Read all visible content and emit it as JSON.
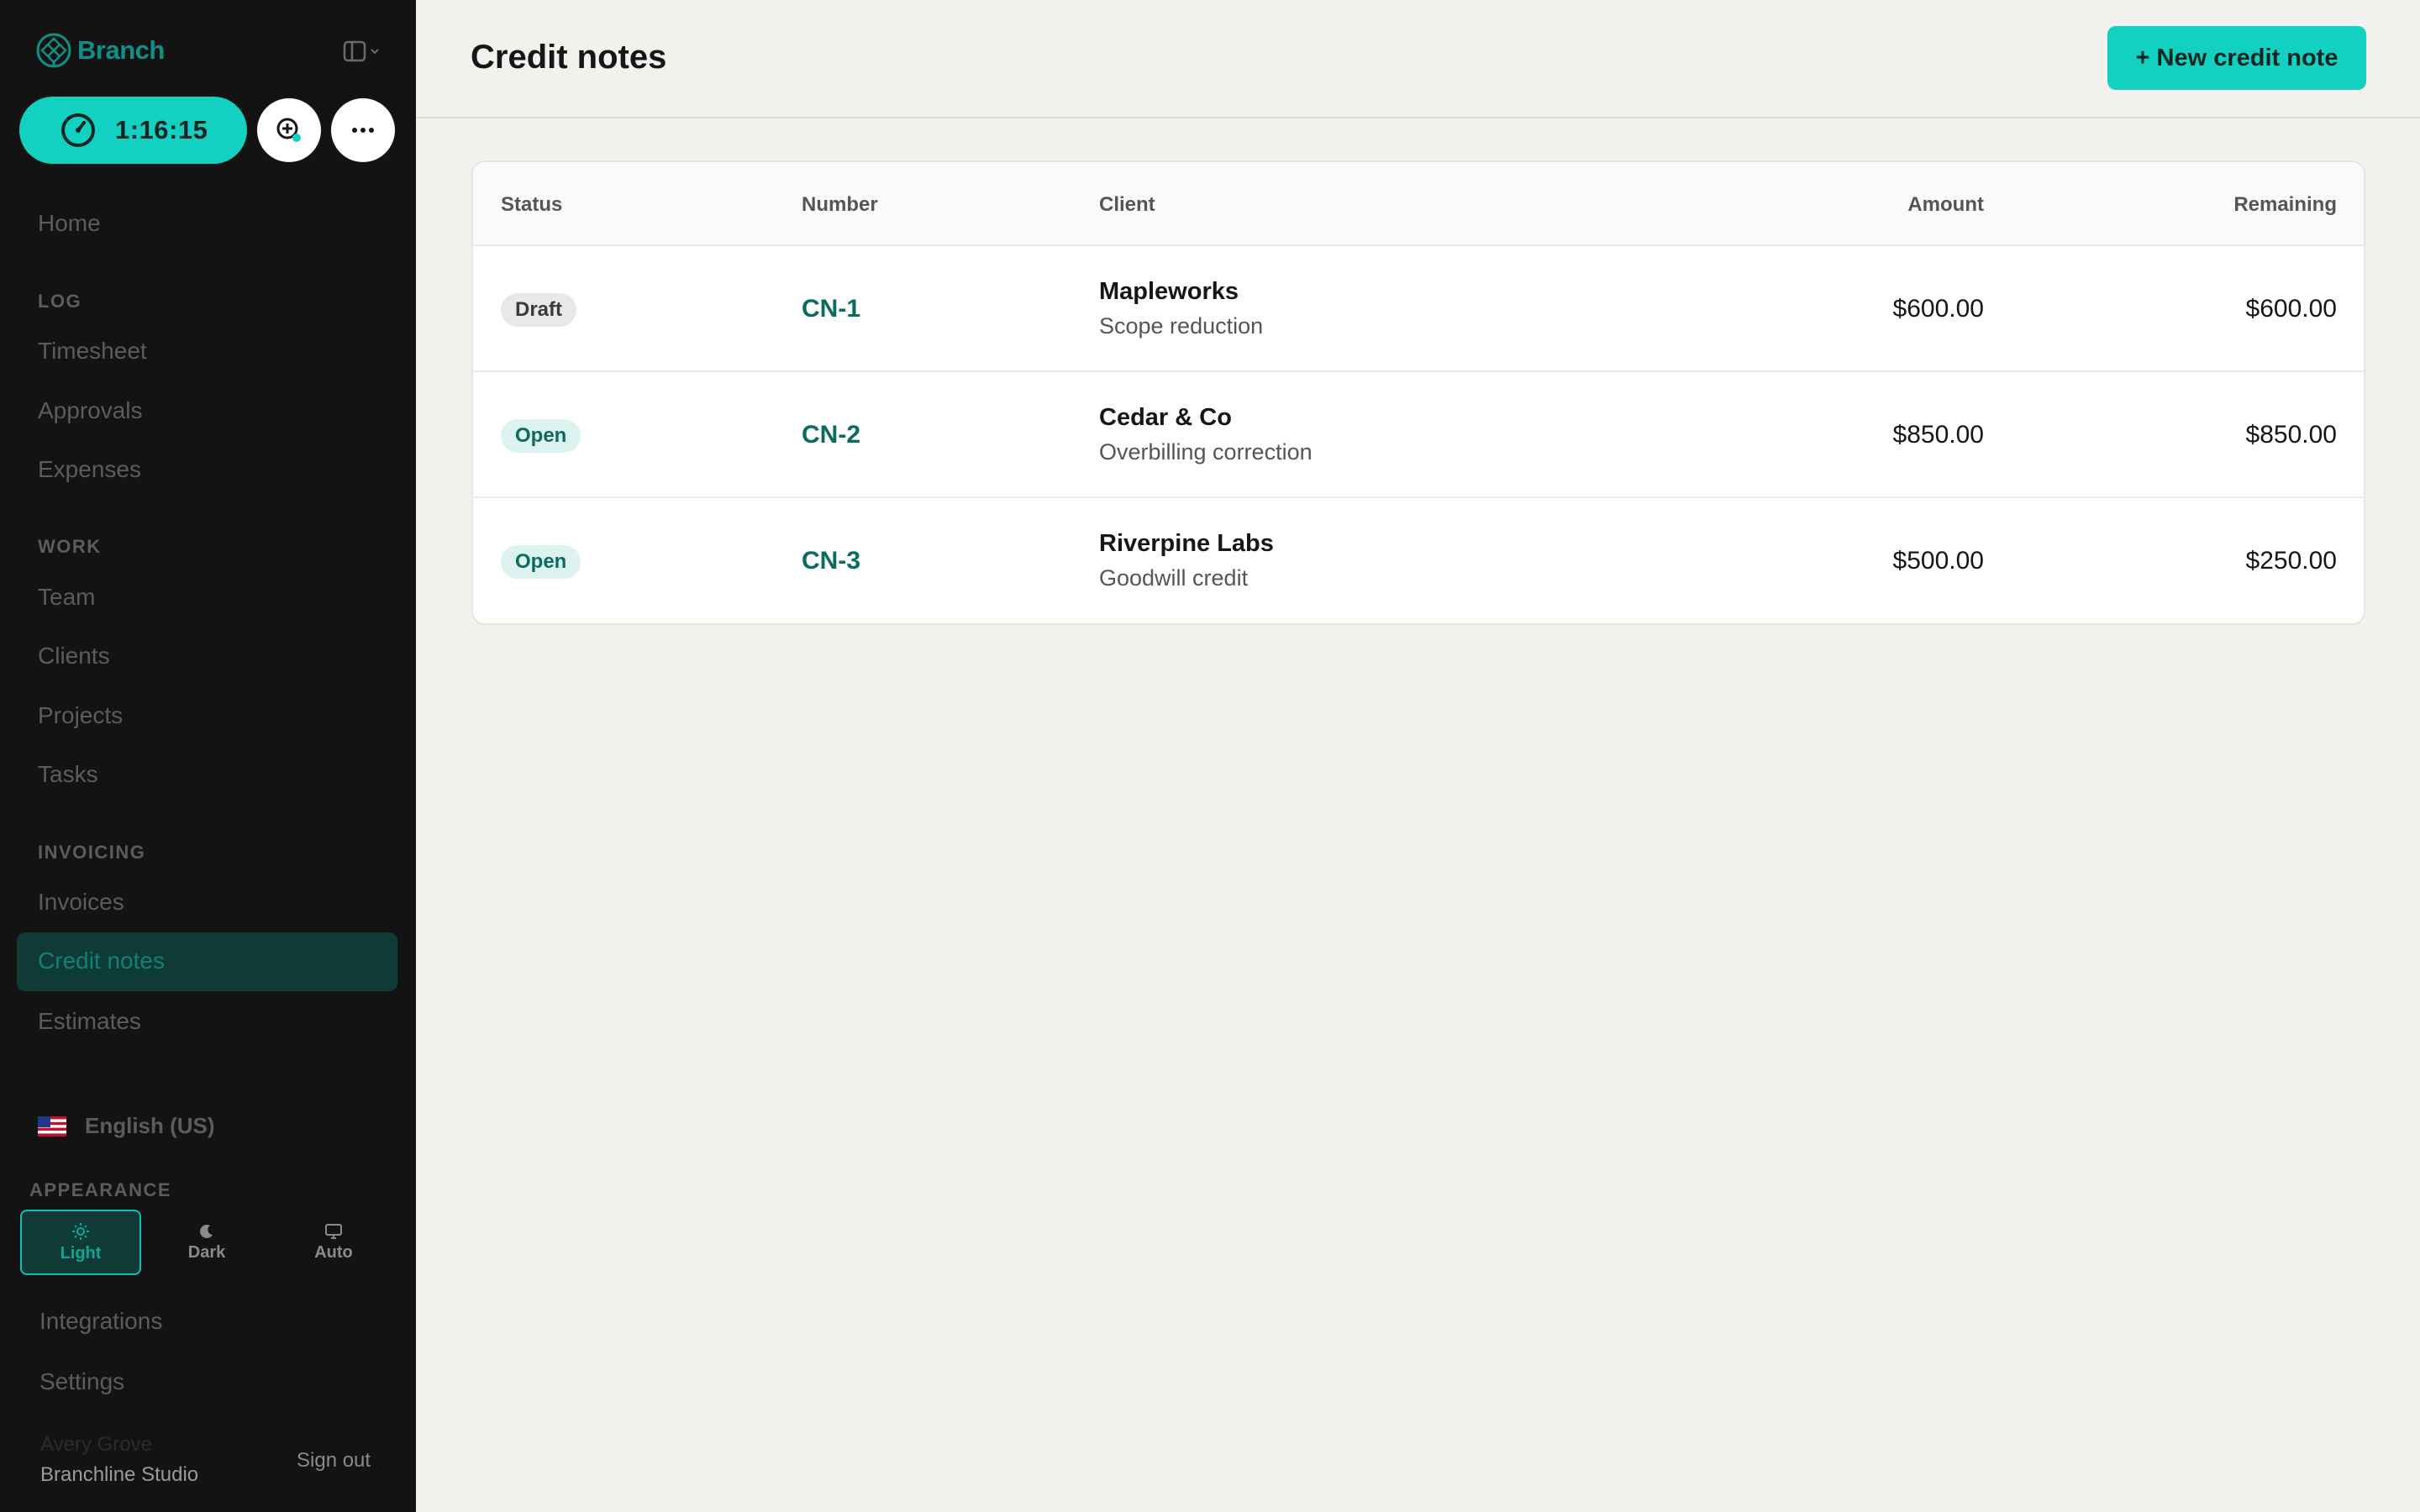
{
  "brand": {
    "name": "Branch",
    "color": "#0f8f85"
  },
  "timer": {
    "value": "1:16:15",
    "color": "#12d1c0"
  },
  "sidebar": {
    "home": "Home",
    "sections": [
      {
        "title": "LOG",
        "items": [
          "Timesheet",
          "Approvals",
          "Expenses"
        ]
      },
      {
        "title": "WORK",
        "items": [
          "Team",
          "Clients",
          "Projects",
          "Tasks"
        ]
      },
      {
        "title": "INVOICING",
        "items": [
          "Invoices",
          "Credit notes",
          "Estimates"
        ]
      }
    ],
    "active_item": "Credit notes",
    "language": "English (US)",
    "appearance": {
      "title": "APPEARANCE",
      "options": [
        "Light",
        "Dark",
        "Auto"
      ],
      "selected": "Light"
    },
    "bottom": [
      "Integrations",
      "Settings"
    ],
    "user_name": "Avery Grove",
    "org": "Branchline Studio",
    "signout": "Sign out"
  },
  "header": {
    "title": "Credit notes",
    "new_button": "+ New credit note"
  },
  "table": {
    "columns": [
      "Status",
      "Number",
      "Client",
      "Amount",
      "Remaining"
    ],
    "rows": [
      {
        "status": "Draft",
        "number": "CN-1",
        "client": "Mapleworks",
        "reason": "Scope reduction",
        "amount": "$600.00",
        "remaining": "$600.00"
      },
      {
        "status": "Open",
        "number": "CN-2",
        "client": "Cedar & Co",
        "reason": "Overbilling correction",
        "amount": "$850.00",
        "remaining": "$850.00"
      },
      {
        "status": "Open",
        "number": "CN-3",
        "client": "Riverpine Labs",
        "reason": "Goodwill credit",
        "amount": "$500.00",
        "remaining": "$250.00"
      }
    ]
  },
  "colors": {
    "accent": "#12d1c0",
    "sidebar_bg": "#131313",
    "page_bg": "#f2f1ed",
    "link": "#0b6b5e"
  }
}
